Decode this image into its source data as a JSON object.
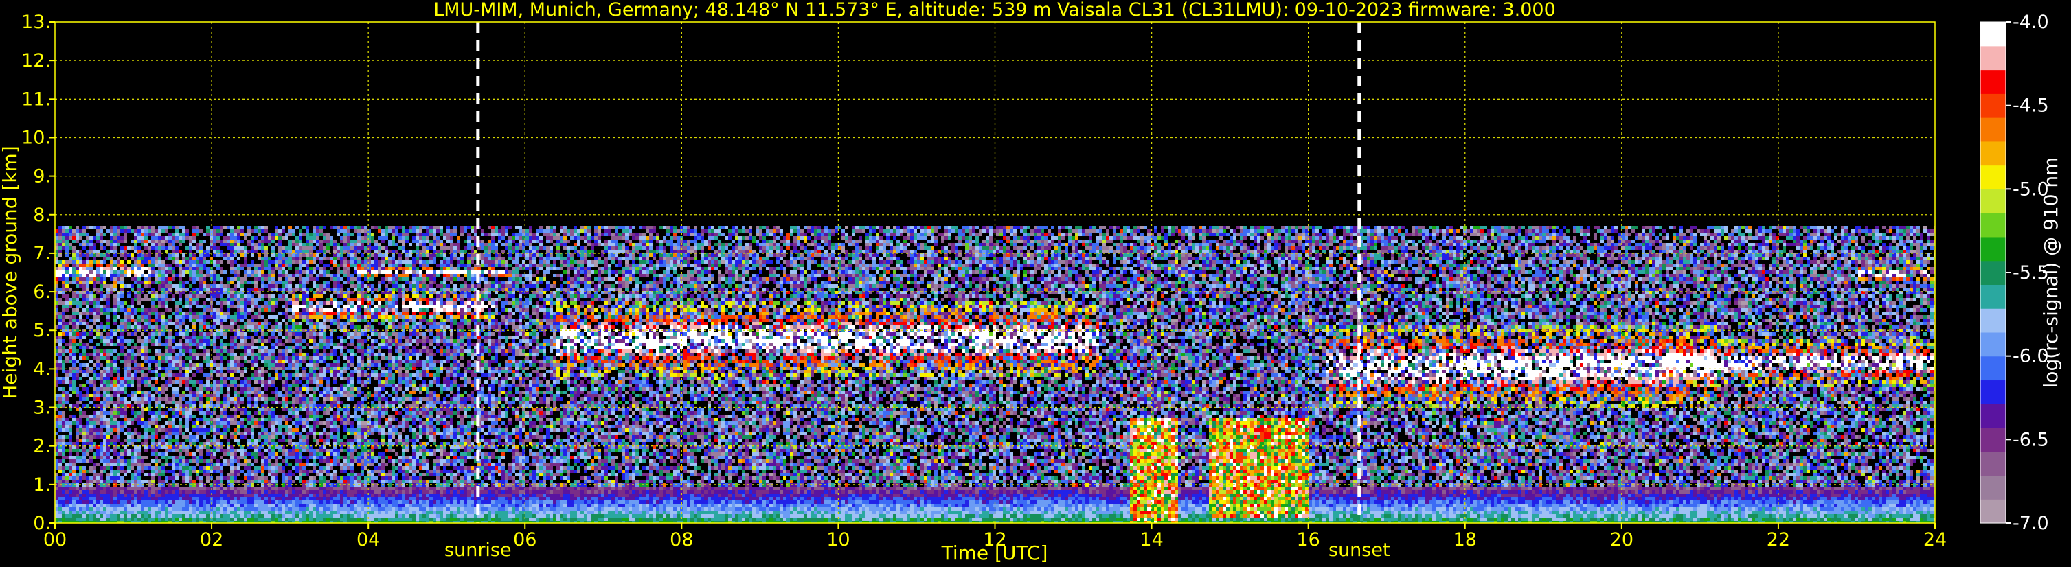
{
  "chart_data": {
    "type": "heatmap",
    "title": "LMU-MIM, Munich, Germany; 48.148° N 11.573° E, altitude: 539 m    Vaisala CL31 (CL31LMU): 09-10-2023    firmware: 3.000",
    "xlabel": "Time [UTC]",
    "ylabel": "Height above ground [km]",
    "xlim": [
      0,
      24
    ],
    "ylim": [
      0,
      13
    ],
    "x_ticks": [
      0,
      2,
      4,
      6,
      8,
      10,
      12,
      14,
      16,
      18,
      20,
      22,
      24
    ],
    "x_tick_labels": [
      "00",
      "02",
      "04",
      "06",
      "08",
      "10",
      "12",
      "14",
      "16",
      "18",
      "20",
      "22",
      "24"
    ],
    "y_ticks": [
      0,
      1,
      2,
      3,
      4,
      5,
      6,
      7,
      8,
      9,
      10,
      11,
      12,
      13
    ],
    "y_tick_labels": [
      "0.",
      "1.",
      "2.",
      "3.",
      "4.",
      "5.",
      "6.",
      "7.",
      "8.",
      "9.",
      "10.",
      "11.",
      "12.",
      "13."
    ],
    "grid": true,
    "measurement_top_km": 7.7,
    "markers": [
      {
        "label": "sunrise",
        "x": 5.4
      },
      {
        "label": "sunset",
        "x": 16.65
      }
    ],
    "colorbar": {
      "label": "log(rc-signal) @ 910 nm",
      "range": [
        -7.0,
        -4.0
      ],
      "ticks": [
        -7.0,
        -6.5,
        -6.0,
        -5.5,
        -5.0,
        -4.5,
        -4.0
      ],
      "tick_labels": [
        "-7.0",
        "-6.5",
        "-6.0",
        "-5.5",
        "-5.0",
        "-4.5",
        "-4.0"
      ],
      "colors": [
        "#b09aac",
        "#9a7d9c",
        "#8c5a90",
        "#7a2d88",
        "#5a14a0",
        "#2222e8",
        "#3c6cf4",
        "#6c9cf4",
        "#9ec0f4",
        "#2aa8a0",
        "#16905a",
        "#16a816",
        "#6cd01e",
        "#c4e82a",
        "#f8f000",
        "#f8b000",
        "#f87800",
        "#f83c00",
        "#f80000",
        "#f6b4b4",
        "#ffffff"
      ]
    },
    "features": [
      {
        "name": "boundary layer aerosol",
        "x": [
          0,
          24
        ],
        "height_km": [
          0,
          1.0
        ]
      },
      {
        "name": "cloud layer",
        "x": [
          0,
          1.2
        ],
        "height_km": [
          6.2,
          6.9
        ]
      },
      {
        "name": "cloud layer",
        "x": [
          3.8,
          5.8
        ],
        "height_km": [
          6.4,
          6.7
        ]
      },
      {
        "name": "cloud layer",
        "x": [
          3.0,
          5.6
        ],
        "height_km": [
          5.3,
          6.0
        ]
      },
      {
        "name": "cloud layer",
        "x": [
          6.4,
          13.3
        ],
        "height_km": [
          3.8,
          5.8
        ]
      },
      {
        "name": "precipitation",
        "x": [
          13.7,
          14.3
        ],
        "height_km": [
          0,
          2.8
        ]
      },
      {
        "name": "precipitation",
        "x": [
          14.7,
          16.0
        ],
        "height_km": [
          0.2,
          2.8
        ]
      },
      {
        "name": "cloud layer",
        "x": [
          16.2,
          21.2
        ],
        "height_km": [
          3.0,
          5.2
        ]
      },
      {
        "name": "cloud layer",
        "x": [
          20.5,
          24
        ],
        "height_km": [
          3.6,
          4.8
        ]
      },
      {
        "name": "cloud layer",
        "x": [
          23.0,
          24
        ],
        "height_km": [
          6.3,
          6.7
        ]
      }
    ]
  }
}
